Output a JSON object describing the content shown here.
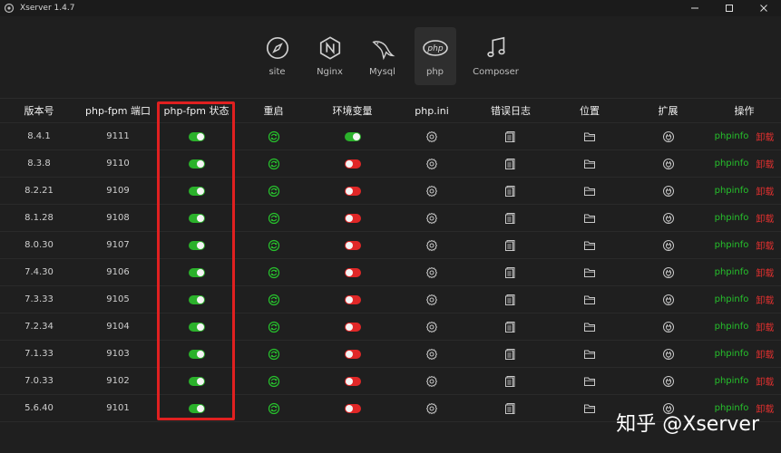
{
  "window": {
    "title": "Xserver 1.4.7"
  },
  "toolbar": {
    "items": [
      {
        "id": "site",
        "label": "site",
        "icon": "compass-icon"
      },
      {
        "id": "nginx",
        "label": "Nginx",
        "icon": "nginx-hexagon-icon"
      },
      {
        "id": "mysql",
        "label": "Mysql",
        "icon": "dolphin-icon"
      },
      {
        "id": "php",
        "label": "php",
        "icon": "php-icon",
        "active": true
      },
      {
        "id": "composer",
        "label": "Composer",
        "icon": "music-note-icon"
      }
    ]
  },
  "table": {
    "headers": [
      "版本号",
      "php-fpm 端口",
      "php-fpm 状态",
      "重启",
      "环境变量",
      "php.ini",
      "错误日志",
      "位置",
      "扩展",
      "操作"
    ],
    "phpinfo_label": "phpinfo",
    "uninstall_label": "卸载",
    "rows": [
      {
        "version": "8.4.1",
        "port": "9111",
        "fpm_on": true,
        "env_on": true
      },
      {
        "version": "8.3.8",
        "port": "9110",
        "fpm_on": true,
        "env_on": false
      },
      {
        "version": "8.2.21",
        "port": "9109",
        "fpm_on": true,
        "env_on": false
      },
      {
        "version": "8.1.28",
        "port": "9108",
        "fpm_on": true,
        "env_on": false
      },
      {
        "version": "8.0.30",
        "port": "9107",
        "fpm_on": true,
        "env_on": false
      },
      {
        "version": "7.4.30",
        "port": "9106",
        "fpm_on": true,
        "env_on": false
      },
      {
        "version": "7.3.33",
        "port": "9105",
        "fpm_on": true,
        "env_on": false
      },
      {
        "version": "7.2.34",
        "port": "9104",
        "fpm_on": true,
        "env_on": false
      },
      {
        "version": "7.1.33",
        "port": "9103",
        "fpm_on": true,
        "env_on": false
      },
      {
        "version": "7.0.33",
        "port": "9102",
        "fpm_on": true,
        "env_on": false
      },
      {
        "version": "5.6.40",
        "port": "9101",
        "fpm_on": true,
        "env_on": false
      }
    ]
  },
  "colors": {
    "toggle_on": "#2bb12b",
    "toggle_off": "#e02727",
    "restart_icon": "#27c22d",
    "phpinfo": "#26c12c",
    "uninstall": "#e0302f",
    "highlight": "#e02020"
  },
  "watermark": "知乎 @Xserver"
}
